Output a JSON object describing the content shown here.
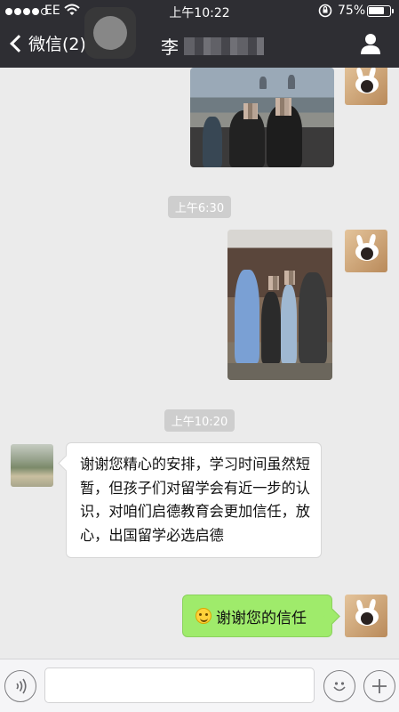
{
  "status_bar": {
    "carrier": "EE",
    "time": "上午10:22",
    "battery": "75%",
    "battery_level": 0.75,
    "signal_bars_filled": 4,
    "signal_bars_total": 5
  },
  "nav": {
    "back_label": "微信(2)",
    "title": "李"
  },
  "messages": {
    "ts1": "上午6:30",
    "ts2": "上午10:20",
    "incoming_text": "谢谢您精心的安排，学习时间虽然短暂，但孩子们对留学会有近一步的认识，对咱们启德教育会更加信任，放心，出国留学必选启德",
    "outgoing_text": "谢谢您的信任"
  },
  "input": {
    "placeholder": ""
  },
  "colors": {
    "nav_bg": "#2e2e33",
    "chat_bg": "#ebebeb",
    "outgoing_bubble": "#9feb6b",
    "incoming_bubble": "#ffffff",
    "timestamp_bg": "#cecece"
  },
  "icons": {
    "back": "chevron-left-icon",
    "profile": "person-icon",
    "voice": "voice-icon",
    "emoji": "emoji-icon",
    "plus": "plus-icon"
  }
}
